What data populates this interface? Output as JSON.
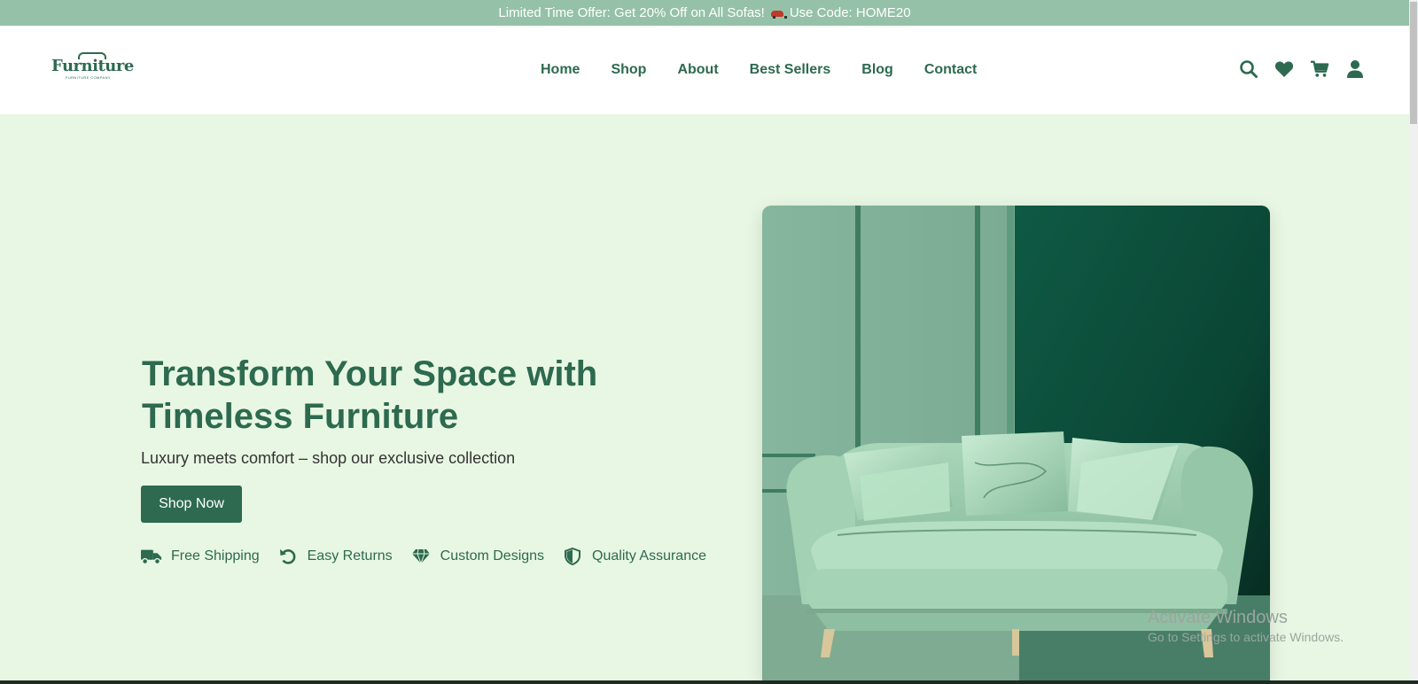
{
  "promo": {
    "text_before": "Limited Time Offer: Get 20% Off on All Sofas!",
    "text_after": "Use Code: HOME20",
    "icon": "car-icon"
  },
  "logo": {
    "word": "Furniture",
    "subtitle": "FURNITURE COMPANY"
  },
  "nav": {
    "items": [
      "Home",
      "Shop",
      "About",
      "Best Sellers",
      "Blog",
      "Contact"
    ]
  },
  "header_icons": [
    "search-icon",
    "heart-icon",
    "cart-icon",
    "user-icon"
  ],
  "hero": {
    "title": "Transform Your Space with Timeless Furniture",
    "subtitle": "Luxury meets comfort – shop our exclusive collection",
    "cta_label": "Shop Now",
    "image_subject": "green tufted sofa with embroidered pillows"
  },
  "features": [
    {
      "label": "Free Shipping",
      "icon": "truck-icon"
    },
    {
      "label": "Easy Returns",
      "icon": "undo-icon"
    },
    {
      "label": "Custom Designs",
      "icon": "diamond-icon"
    },
    {
      "label": "Quality Assurance",
      "icon": "shield-icon"
    }
  ],
  "watermark": {
    "line1": "Activate Windows",
    "line2": "Go to Settings to activate Windows."
  },
  "colors": {
    "brand": "#2d6a4f",
    "promo_bg": "#95c1a8",
    "page_bg": "#e8f7e3"
  }
}
